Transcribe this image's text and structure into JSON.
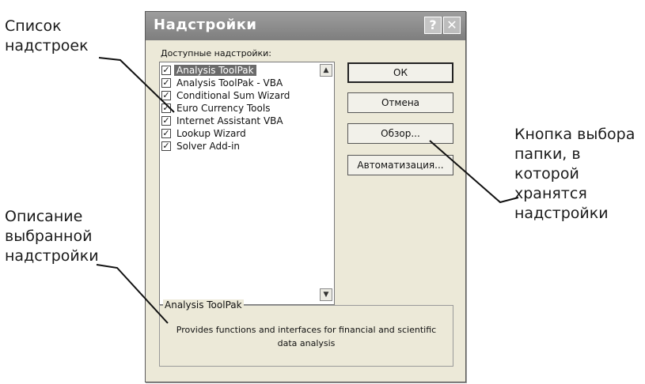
{
  "callouts": {
    "addin_list": "Список\nнадстроек",
    "description": "Описание\nвыбранной\nнадстройки",
    "browse_button": "Кнопка выбора\nпапки, в которой\nхранятся\nнадстройки"
  },
  "dialog": {
    "title": "Надстройки",
    "help_icon": "question-mark",
    "close_icon": "close-x",
    "list_label": "Доступные надстройки:",
    "addins": [
      {
        "label": "Analysis ToolPak",
        "checked": true,
        "selected": true
      },
      {
        "label": "Analysis ToolPak - VBA",
        "checked": true,
        "selected": false
      },
      {
        "label": "Conditional Sum Wizard",
        "checked": true,
        "selected": false
      },
      {
        "label": "Euro Currency Tools",
        "checked": true,
        "selected": false
      },
      {
        "label": "Internet Assistant VBA",
        "checked": true,
        "selected": false
      },
      {
        "label": "Lookup Wizard",
        "checked": true,
        "selected": false
      },
      {
        "label": "Solver Add-in",
        "checked": true,
        "selected": false
      }
    ],
    "buttons": {
      "ok": "ОК",
      "cancel": "Отмена",
      "browse": "Обзор...",
      "automation": "Автоматизация..."
    },
    "description": {
      "title": "Analysis ToolPak",
      "text": "Provides functions and interfaces for financial and scientific data analysis"
    }
  },
  "colors": {
    "titlebar": "#8a8a8a",
    "dialog_bg": "#ece9d8",
    "selection": "#6b6b6b"
  }
}
